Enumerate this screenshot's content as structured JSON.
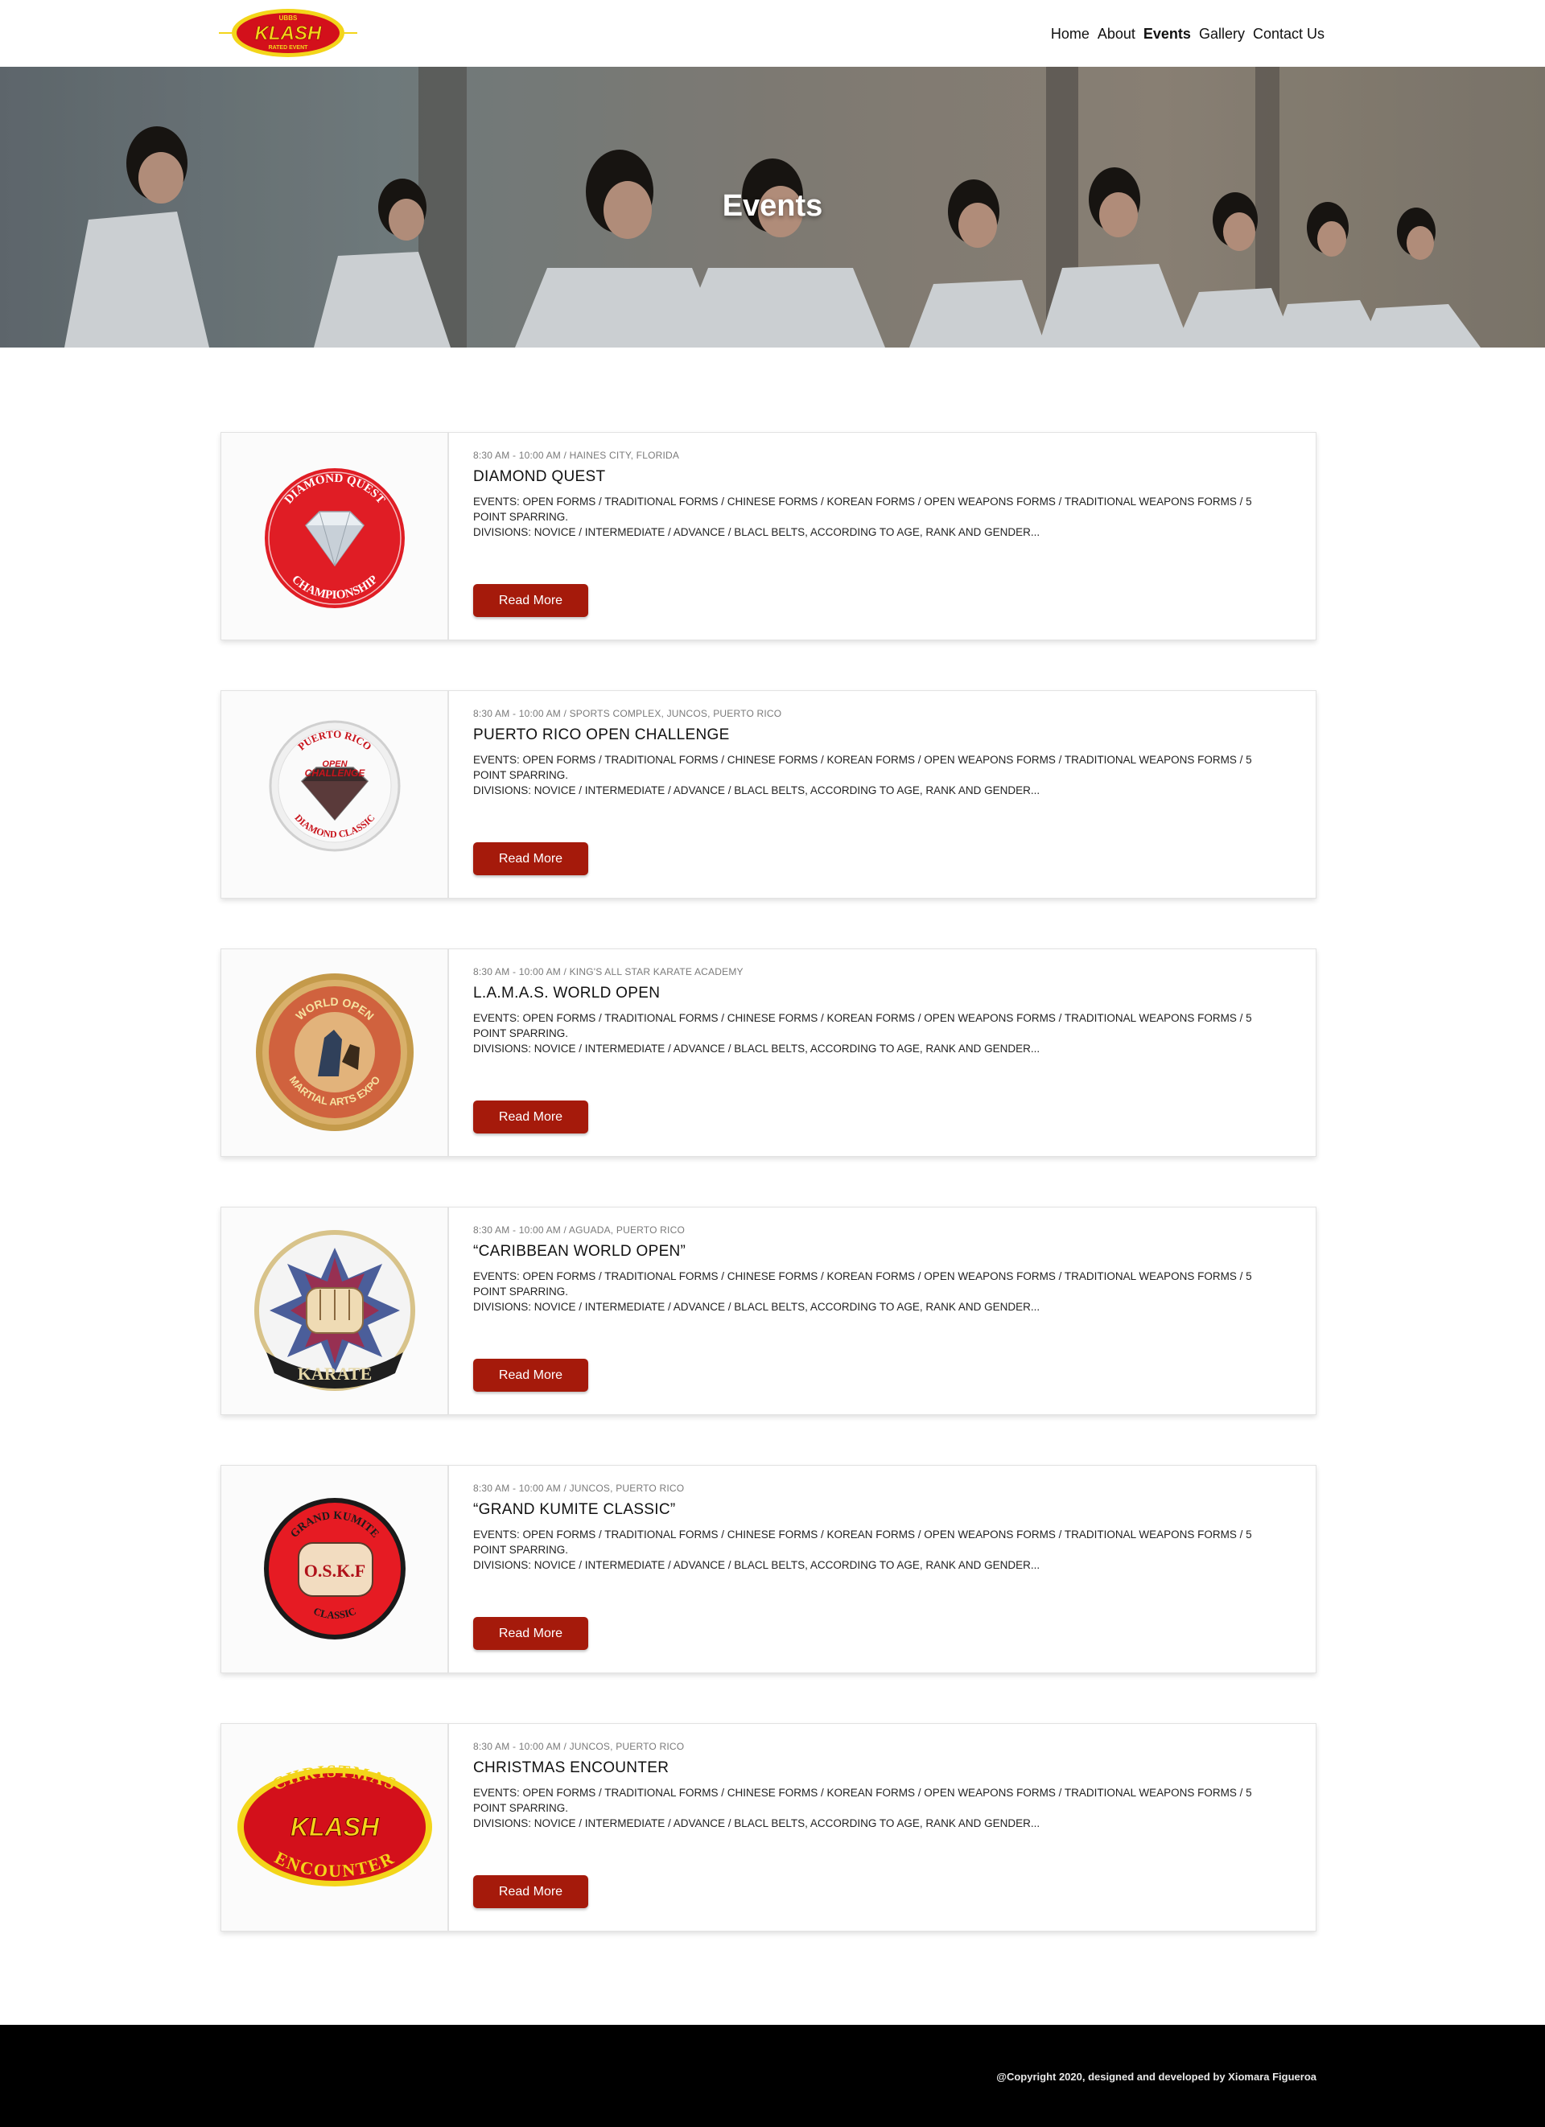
{
  "header": {
    "logo": {
      "top_text": "UBBS",
      "main_text": "KLASH",
      "bottom_text": "RATED EVENT"
    },
    "nav": [
      "Home",
      "About",
      "Events",
      "Gallery",
      "Contact Us"
    ],
    "active_nav": "Events"
  },
  "hero": {
    "title": "Events"
  },
  "read_more_label": "Read More",
  "events": [
    {
      "meta": "8:30 AM - 10:00 AM / HAINES CITY, FLORIDA",
      "title": "DIAMOND QUEST",
      "desc_line1": "EVENTS: OPEN FORMS / TRADITIONAL FORMS / CHINESE FORMS / KOREAN FORMS / OPEN WEAPONS FORMS / TRADITIONAL WEAPONS FORMS / 5 POINT SPARRING.",
      "desc_line2": "DIVISIONS: NOVICE / INTERMEDIATE / ADVANCE / BLACL BELTS, ACCORDING TO AGE, RANK AND GENDER...",
      "badge_top": "DIAMOND QUEST",
      "badge_bottom": "CHAMPIONSHIP"
    },
    {
      "meta": "8:30 AM - 10:00 AM / SPORTS COMPLEX, JUNCOS, PUERTO RICO",
      "title": "PUERTO RICO OPEN CHALLENGE",
      "desc_line1": "EVENTS: OPEN FORMS / TRADITIONAL FORMS / CHINESE FORMS / KOREAN FORMS / OPEN WEAPONS FORMS / TRADITIONAL WEAPONS FORMS / 5 POINT SPARRING.",
      "desc_line2": "DIVISIONS: NOVICE / INTERMEDIATE / ADVANCE / BLACL BELTS, ACCORDING TO AGE, RANK AND GENDER...",
      "badge_top": "PUERTO RICO",
      "badge_mid1": "OPEN",
      "badge_mid2": "CHALLENGE",
      "badge_bottom": "DIAMOND CLASSIC"
    },
    {
      "meta": "8:30 AM - 10:00 AM / KING'S ALL STAR KARATE ACADEMY",
      "title": "L.A.M.A.S. WORLD OPEN",
      "desc_line1": "EVENTS: OPEN FORMS / TRADITIONAL FORMS / CHINESE FORMS / KOREAN FORMS / OPEN WEAPONS FORMS / TRADITIONAL WEAPONS FORMS / 5 POINT SPARRING.",
      "desc_line2": "DIVISIONS: NOVICE / INTERMEDIATE / ADVANCE / BLACL BELTS, ACCORDING TO AGE, RANK AND GENDER...",
      "badge_top": "WORLD OPEN",
      "badge_bottom": "MARTIAL ARTS EXPO"
    },
    {
      "meta": "8:30 AM - 10:00 AM / AGUADA, PUERTO RICO",
      "title": "“CARIBBEAN WORLD OPEN”",
      "desc_line1": "EVENTS: OPEN FORMS / TRADITIONAL FORMS / CHINESE FORMS / KOREAN FORMS / OPEN WEAPONS FORMS / TRADITIONAL WEAPONS FORMS / 5 POINT SPARRING.",
      "desc_line2": "DIVISIONS: NOVICE / INTERMEDIATE / ADVANCE / BLACL BELTS, ACCORDING TO AGE, RANK AND GENDER...",
      "badge_bottom": "KARATE"
    },
    {
      "meta": "8:30 AM - 10:00 AM / JUNCOS, PUERTO RICO",
      "title": "“GRAND KUMITE CLASSIC”",
      "desc_line1": "EVENTS: OPEN FORMS / TRADITIONAL FORMS / CHINESE FORMS / KOREAN FORMS / OPEN WEAPONS FORMS / TRADITIONAL WEAPONS FORMS / 5 POINT SPARRING.",
      "desc_line2": "DIVISIONS: NOVICE / INTERMEDIATE / ADVANCE / BLACL BELTS, ACCORDING TO AGE, RANK AND GENDER...",
      "badge_top": "GRAND KUMITE",
      "badge_mid1": "O.S.K.F",
      "badge_bottom": "CLASSIC"
    },
    {
      "meta": "8:30 AM - 10:00 AM /  JUNCOS, PUERTO RICO",
      "title": "CHRISTMAS ENCOUNTER",
      "desc_line1": "EVENTS: OPEN FORMS / TRADITIONAL FORMS / CHINESE FORMS / KOREAN FORMS / OPEN WEAPONS FORMS / TRADITIONAL WEAPONS FORMS / 5 POINT SPARRING.",
      "desc_line2": "DIVISIONS: NOVICE / INTERMEDIATE / ADVANCE / BLACL BELTS, ACCORDING TO AGE, RANK AND GENDER...",
      "badge_top": "CHRISTMAS",
      "badge_mid1": "KLASH",
      "badge_bottom": "ENCOUNTER"
    }
  ],
  "footer": {
    "copyright": "@Copyright 2020, designed and developed by Xiomara Figueroa"
  },
  "colors": {
    "accent": "#a51a0b",
    "footer_bg": "#000000",
    "logo_red": "#d3101b",
    "logo_yellow": "#f3d51a"
  }
}
